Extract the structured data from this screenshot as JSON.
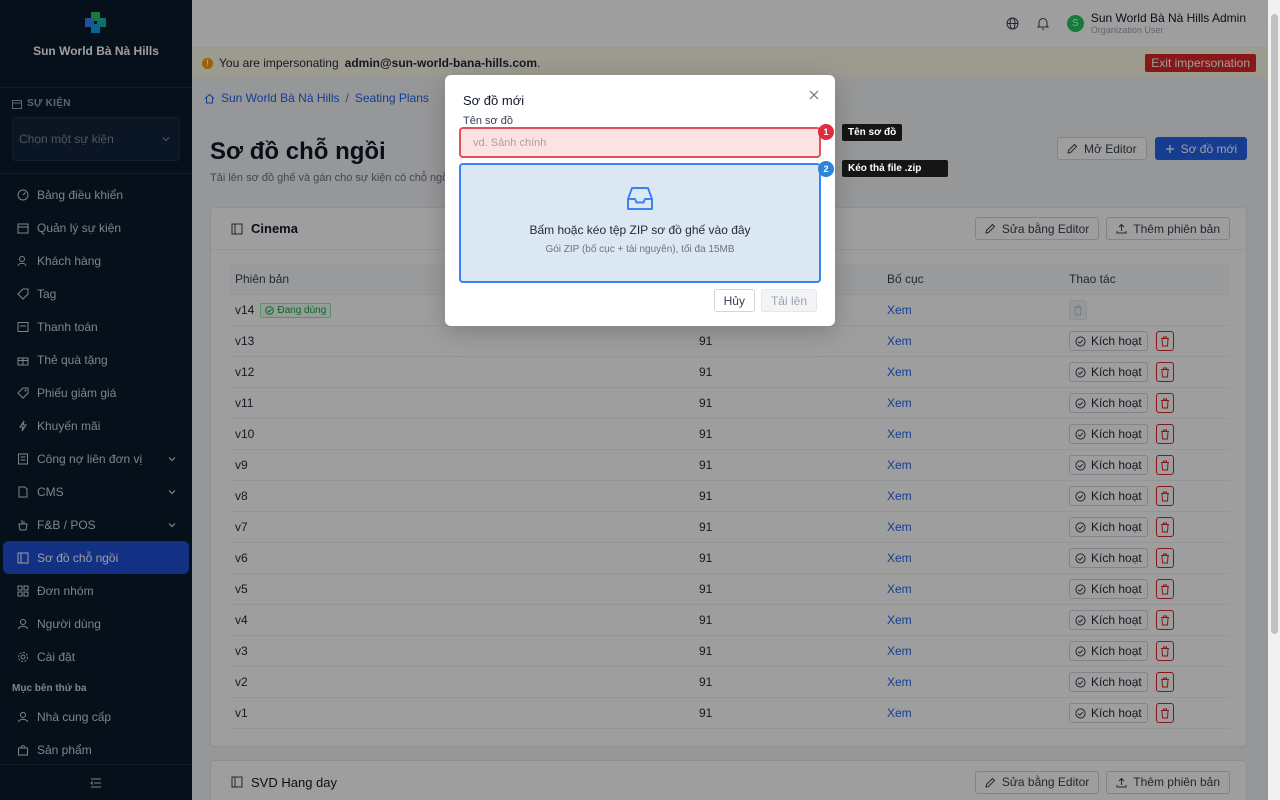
{
  "app": {
    "brand_name": "Sun World Bà Nà Hills"
  },
  "sidebar": {
    "section_label": "SỰ KIỆN",
    "event_select_placeholder": "Chọn một sự kiện",
    "items": [
      {
        "label": "Bảng điều khiển",
        "icon": "dashboard-icon"
      },
      {
        "label": "Quản lý sự kiện",
        "icon": "calendar-icon"
      },
      {
        "label": "Khách hàng",
        "icon": "users-icon"
      },
      {
        "label": "Tag",
        "icon": "tag-icon"
      },
      {
        "label": "Thanh toán",
        "icon": "payment-icon"
      },
      {
        "label": "Thẻ quà tặng",
        "icon": "gift-icon"
      },
      {
        "label": "Phiếu giảm giá",
        "icon": "coupon-icon"
      },
      {
        "label": "Khuyến mãi",
        "icon": "promotion-icon"
      },
      {
        "label": "Công nợ liên đơn vị",
        "icon": "ledger-icon"
      },
      {
        "label": "CMS",
        "icon": "document-icon"
      },
      {
        "label": "F&B / POS",
        "icon": "food-icon"
      },
      {
        "label": "Sơ đồ chỗ ngồi",
        "icon": "seating-icon"
      },
      {
        "label": "Đơn nhóm",
        "icon": "group-icon"
      },
      {
        "label": "Người dùng",
        "icon": "user-icon"
      },
      {
        "label": "Cài đặt",
        "icon": "gear-icon"
      }
    ],
    "group_label": "Mục bên thứ ba",
    "third_party_items": [
      {
        "label": "Nhà cung cấp",
        "icon": "user-icon"
      },
      {
        "label": "Sản phẩm",
        "icon": "bag-icon"
      }
    ]
  },
  "topbar": {
    "user_initial": "S",
    "user_name": "Sun World Bà Nà Hills Admin",
    "user_role": "Organization User"
  },
  "banner": {
    "prefix": "You are impersonating",
    "email": "admin@sun-world-bana-hills.com",
    "suffix": ".",
    "exit_label": "Exit impersonation"
  },
  "breadcrumb": {
    "home": "Sun World Bà Nà Hills",
    "separator": "/",
    "current": "Seating Plans"
  },
  "page": {
    "title": "Sơ đồ chỗ ngồi",
    "subtitle": "Tải lên sơ đồ ghế và gán cho sự kiện có chỗ ngồi",
    "open_editor_label": "Mở Editor",
    "new_plan_label": "Sơ đồ mới"
  },
  "plan_card": {
    "title": "Cinema",
    "edit_label": "Sửa bằng Editor",
    "add_version_label": "Thêm phiên bản",
    "columns": [
      "Phiên bản",
      "",
      "Bố cục",
      "Thao tác"
    ],
    "active_tag": "Đang dùng",
    "view_label": "Xem",
    "activate_label": "Kích hoạt",
    "rows": [
      {
        "version": "v14",
        "seats": "",
        "active": true
      },
      {
        "version": "v13",
        "seats": "91",
        "active": false
      },
      {
        "version": "v12",
        "seats": "91",
        "active": false
      },
      {
        "version": "v11",
        "seats": "91",
        "active": false
      },
      {
        "version": "v10",
        "seats": "91",
        "active": false
      },
      {
        "version": "v9",
        "seats": "91",
        "active": false
      },
      {
        "version": "v8",
        "seats": "91",
        "active": false
      },
      {
        "version": "v7",
        "seats": "91",
        "active": false
      },
      {
        "version": "v6",
        "seats": "91",
        "active": false
      },
      {
        "version": "v5",
        "seats": "91",
        "active": false
      },
      {
        "version": "v4",
        "seats": "91",
        "active": false
      },
      {
        "version": "v3",
        "seats": "91",
        "active": false
      },
      {
        "version": "v2",
        "seats": "91",
        "active": false
      },
      {
        "version": "v1",
        "seats": "91",
        "active": false
      }
    ]
  },
  "plan_card_2": {
    "title": "SVD Hang day",
    "edit_label": "Sửa bằng Editor",
    "add_version_label": "Thêm phiên bản"
  },
  "modal": {
    "title": "Sơ đồ mới",
    "name_label": "Tên sơ đồ",
    "name_placeholder": "vd. Sảnh chính",
    "name_value": "",
    "dropzone_title": "Bấm hoặc kéo tệp ZIP sơ đồ ghế vào đây",
    "dropzone_hint": "Gói ZIP (bố cục + tài nguyên), tối đa 15MB",
    "cancel_label": "Hủy",
    "upload_label": "Tải lên"
  },
  "annotations": [
    {
      "number": "1",
      "text": "Tên sơ đồ",
      "color": "#e02c3f"
    },
    {
      "number": "2",
      "text": "Kéo thả file .zip",
      "color": "#2b86d9"
    }
  ]
}
